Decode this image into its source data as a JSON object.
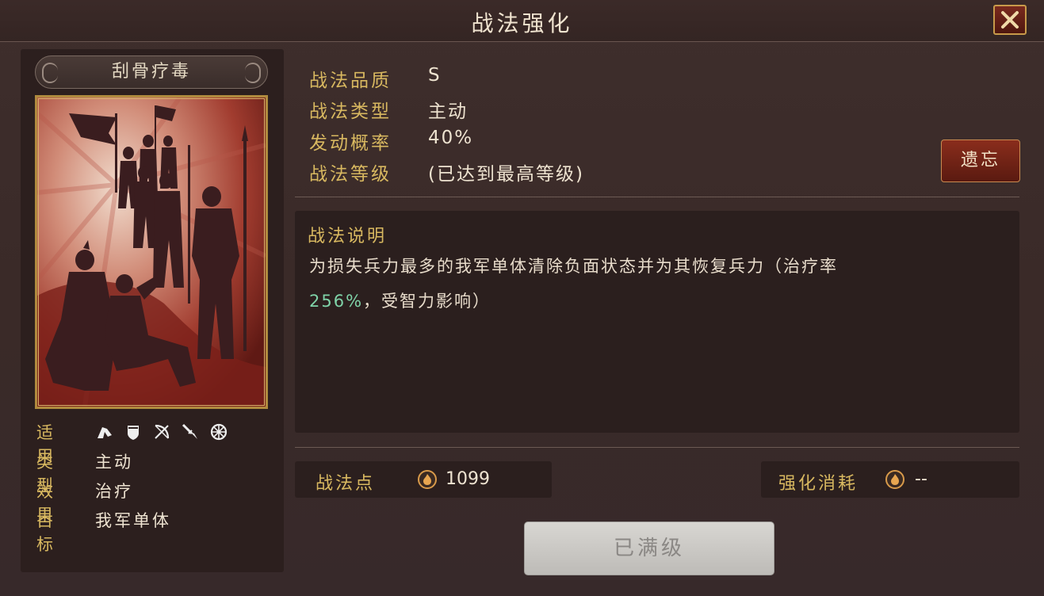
{
  "window": {
    "title": "战法强化",
    "close_icon": "close-icon"
  },
  "skill": {
    "name": "刮骨疗毒",
    "card_art": "silhouette-troops-healing-scene"
  },
  "summary": {
    "applicable_label": "适用",
    "applicable_icons": [
      "cavalry-icon",
      "shield-icon",
      "archer-icon",
      "spear-icon",
      "siege-icon"
    ],
    "type_label": "类型",
    "type_value": "主动",
    "effect_label": "效果",
    "effect_value": "治疗",
    "target_label": "目标",
    "target_value": "我军单体"
  },
  "attributes": [
    {
      "label": "战法品质",
      "value": "S"
    },
    {
      "label": "战法类型",
      "value": "主动"
    },
    {
      "label": "发动概率",
      "value": "40%"
    },
    {
      "label": "战法等级",
      "value": "(已达到最高等级)"
    }
  ],
  "forget_button": "遗忘",
  "description": {
    "title": "战法说明",
    "text_part1": "为损失兵力最多的我军单体清除负面状态并为其恢复兵力（治疗率",
    "highlight": "256%",
    "text_part2": "，受智力影响）"
  },
  "points": {
    "label": "战法点",
    "value": "1099"
  },
  "cost": {
    "label": "强化消耗",
    "value": "--"
  },
  "max_button": "已满级",
  "colors": {
    "gold": "#d8b860",
    "highlight_green": "#7fd3a8",
    "button_red": "#8a2d1c"
  }
}
